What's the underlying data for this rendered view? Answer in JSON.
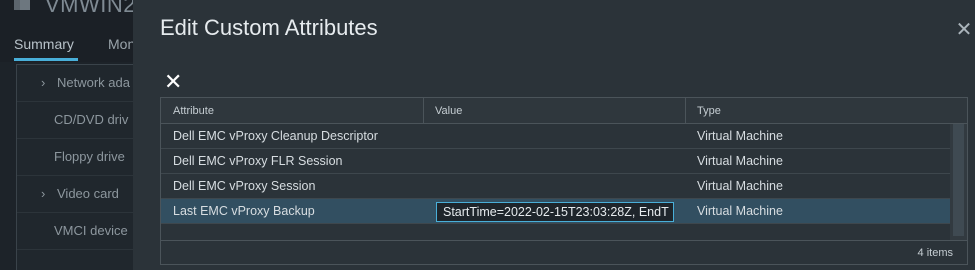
{
  "background": {
    "vm_title": "VMWIN2",
    "tabs": [
      "Summary",
      "Mon"
    ],
    "hardware_rows": [
      {
        "label": "Network ada",
        "expandable": true
      },
      {
        "label": "CD/DVD driv",
        "expandable": false
      },
      {
        "label": "Floppy drive",
        "expandable": false
      },
      {
        "label": "Video card",
        "expandable": true
      },
      {
        "label": "VMCI device",
        "expandable": false
      }
    ]
  },
  "modal": {
    "title": "Edit Custom Attributes",
    "close_icon": "close-icon",
    "remove_icon": "x-icon",
    "columns": [
      "Attribute",
      "Value",
      "Type"
    ],
    "rows": [
      {
        "attribute": "Dell EMC vProxy Cleanup Descriptor",
        "value": "",
        "type": "Virtual Machine"
      },
      {
        "attribute": "Dell EMC vProxy FLR Session",
        "value": "",
        "type": "Virtual Machine"
      },
      {
        "attribute": "Dell EMC vProxy Session",
        "value": "",
        "type": "Virtual Machine"
      },
      {
        "attribute": "Last EMC vProxy Backup",
        "value": "StartTime=2022-02-15T23:03:28Z, EndT",
        "type": "Virtual Machine",
        "selected": true
      }
    ],
    "footer_count": "4 items"
  },
  "colors": {
    "accent": "#49afd9",
    "selected_row": "#324f61",
    "modal_bg": "#2b3339"
  }
}
